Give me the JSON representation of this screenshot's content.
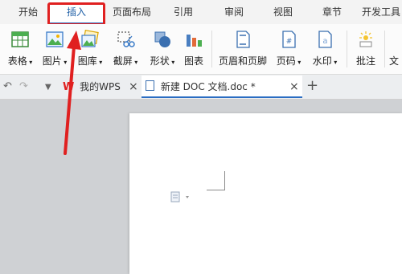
{
  "menu": {
    "tabs": [
      "开始",
      "插入",
      "页面布局",
      "引用",
      "审阅",
      "视图",
      "章节",
      "开发工具"
    ],
    "active": "插入"
  },
  "ribbon": {
    "table": "表格",
    "picture": "图片",
    "gallery": "图库",
    "screenshot": "截屏",
    "shapes": "形状",
    "chart": "图表",
    "header_footer": "页眉和页脚",
    "page_number": "页码",
    "watermark": "水印",
    "comment": "批注",
    "text": "文"
  },
  "docbar": {
    "tab_wps": "我的WPS",
    "tab_doc": "新建 DOC 文档.doc *"
  },
  "colors": {
    "highlight": "#e02020",
    "accent": "#2b6dc2"
  }
}
